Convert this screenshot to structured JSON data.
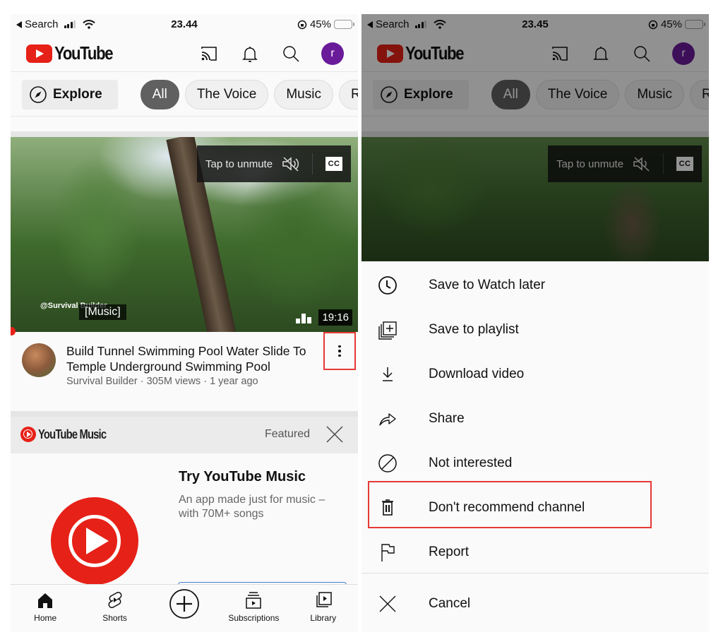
{
  "left": {
    "status_bar": {
      "back_label": "Search",
      "time": "23.44",
      "battery": "45%",
      "battery_level": 0.45
    },
    "header": {
      "logo_text": "YouTube",
      "avatar_initial": "r",
      "icons": [
        "cast-icon",
        "bell-icon",
        "search-icon"
      ]
    },
    "chips": {
      "explore_label": "Explore",
      "items": [
        "All",
        "The Voice",
        "Music",
        "Ra"
      ],
      "active_index": 0
    },
    "video": {
      "unmute_label": "Tap to unmute",
      "cc_label": "CC",
      "watermark": "@Survival Builder",
      "caption": "[Music]",
      "duration": "19:16",
      "title": "Build Tunnel  Swimming Pool Water Slide To Temple Underground Swimming Pool",
      "subtitle": "Survival Builder · 305M views · 1 year ago"
    },
    "promo": {
      "brand": "YouTube Music",
      "featured_label": "Featured",
      "title": "Try YouTube Music",
      "description": "An app made just for music – with 70M+ songs"
    },
    "bottom_nav": [
      {
        "label": "Home",
        "icon": "home-icon"
      },
      {
        "label": "Shorts",
        "icon": "shorts-icon"
      },
      {
        "label": "",
        "icon": "create-icon"
      },
      {
        "label": "Subscriptions",
        "icon": "subscriptions-icon"
      },
      {
        "label": "Library",
        "icon": "library-icon"
      }
    ]
  },
  "right": {
    "status_bar": {
      "back_label": "Search",
      "time": "23.45",
      "battery": "45%",
      "battery_level": 0.45
    },
    "header": {
      "logo_text": "YouTube",
      "avatar_initial": "r"
    },
    "chips": {
      "explore_label": "Explore",
      "items": [
        "All",
        "The Voice",
        "Music",
        "Ra"
      ],
      "active_index": 0
    },
    "video": {
      "unmute_label": "Tap to unmute",
      "cc_label": "CC"
    },
    "menu": [
      {
        "label": "Save to Watch later",
        "icon": "clock-icon"
      },
      {
        "label": "Save to playlist",
        "icon": "playlist-add-icon"
      },
      {
        "label": "Download video",
        "icon": "download-icon"
      },
      {
        "label": "Share",
        "icon": "share-icon"
      },
      {
        "label": "Not interested",
        "icon": "block-icon"
      },
      {
        "label": "Don't recommend channel",
        "icon": "trash-icon",
        "highlighted": true
      },
      {
        "label": "Report",
        "icon": "flag-icon"
      },
      {
        "label": "Cancel",
        "icon": "close-icon"
      }
    ]
  },
  "colors": {
    "brand_red": "#e62117",
    "highlight_box": "#e53935",
    "avatar_purple": "#6a1b9a",
    "active_chip": "#606060"
  }
}
